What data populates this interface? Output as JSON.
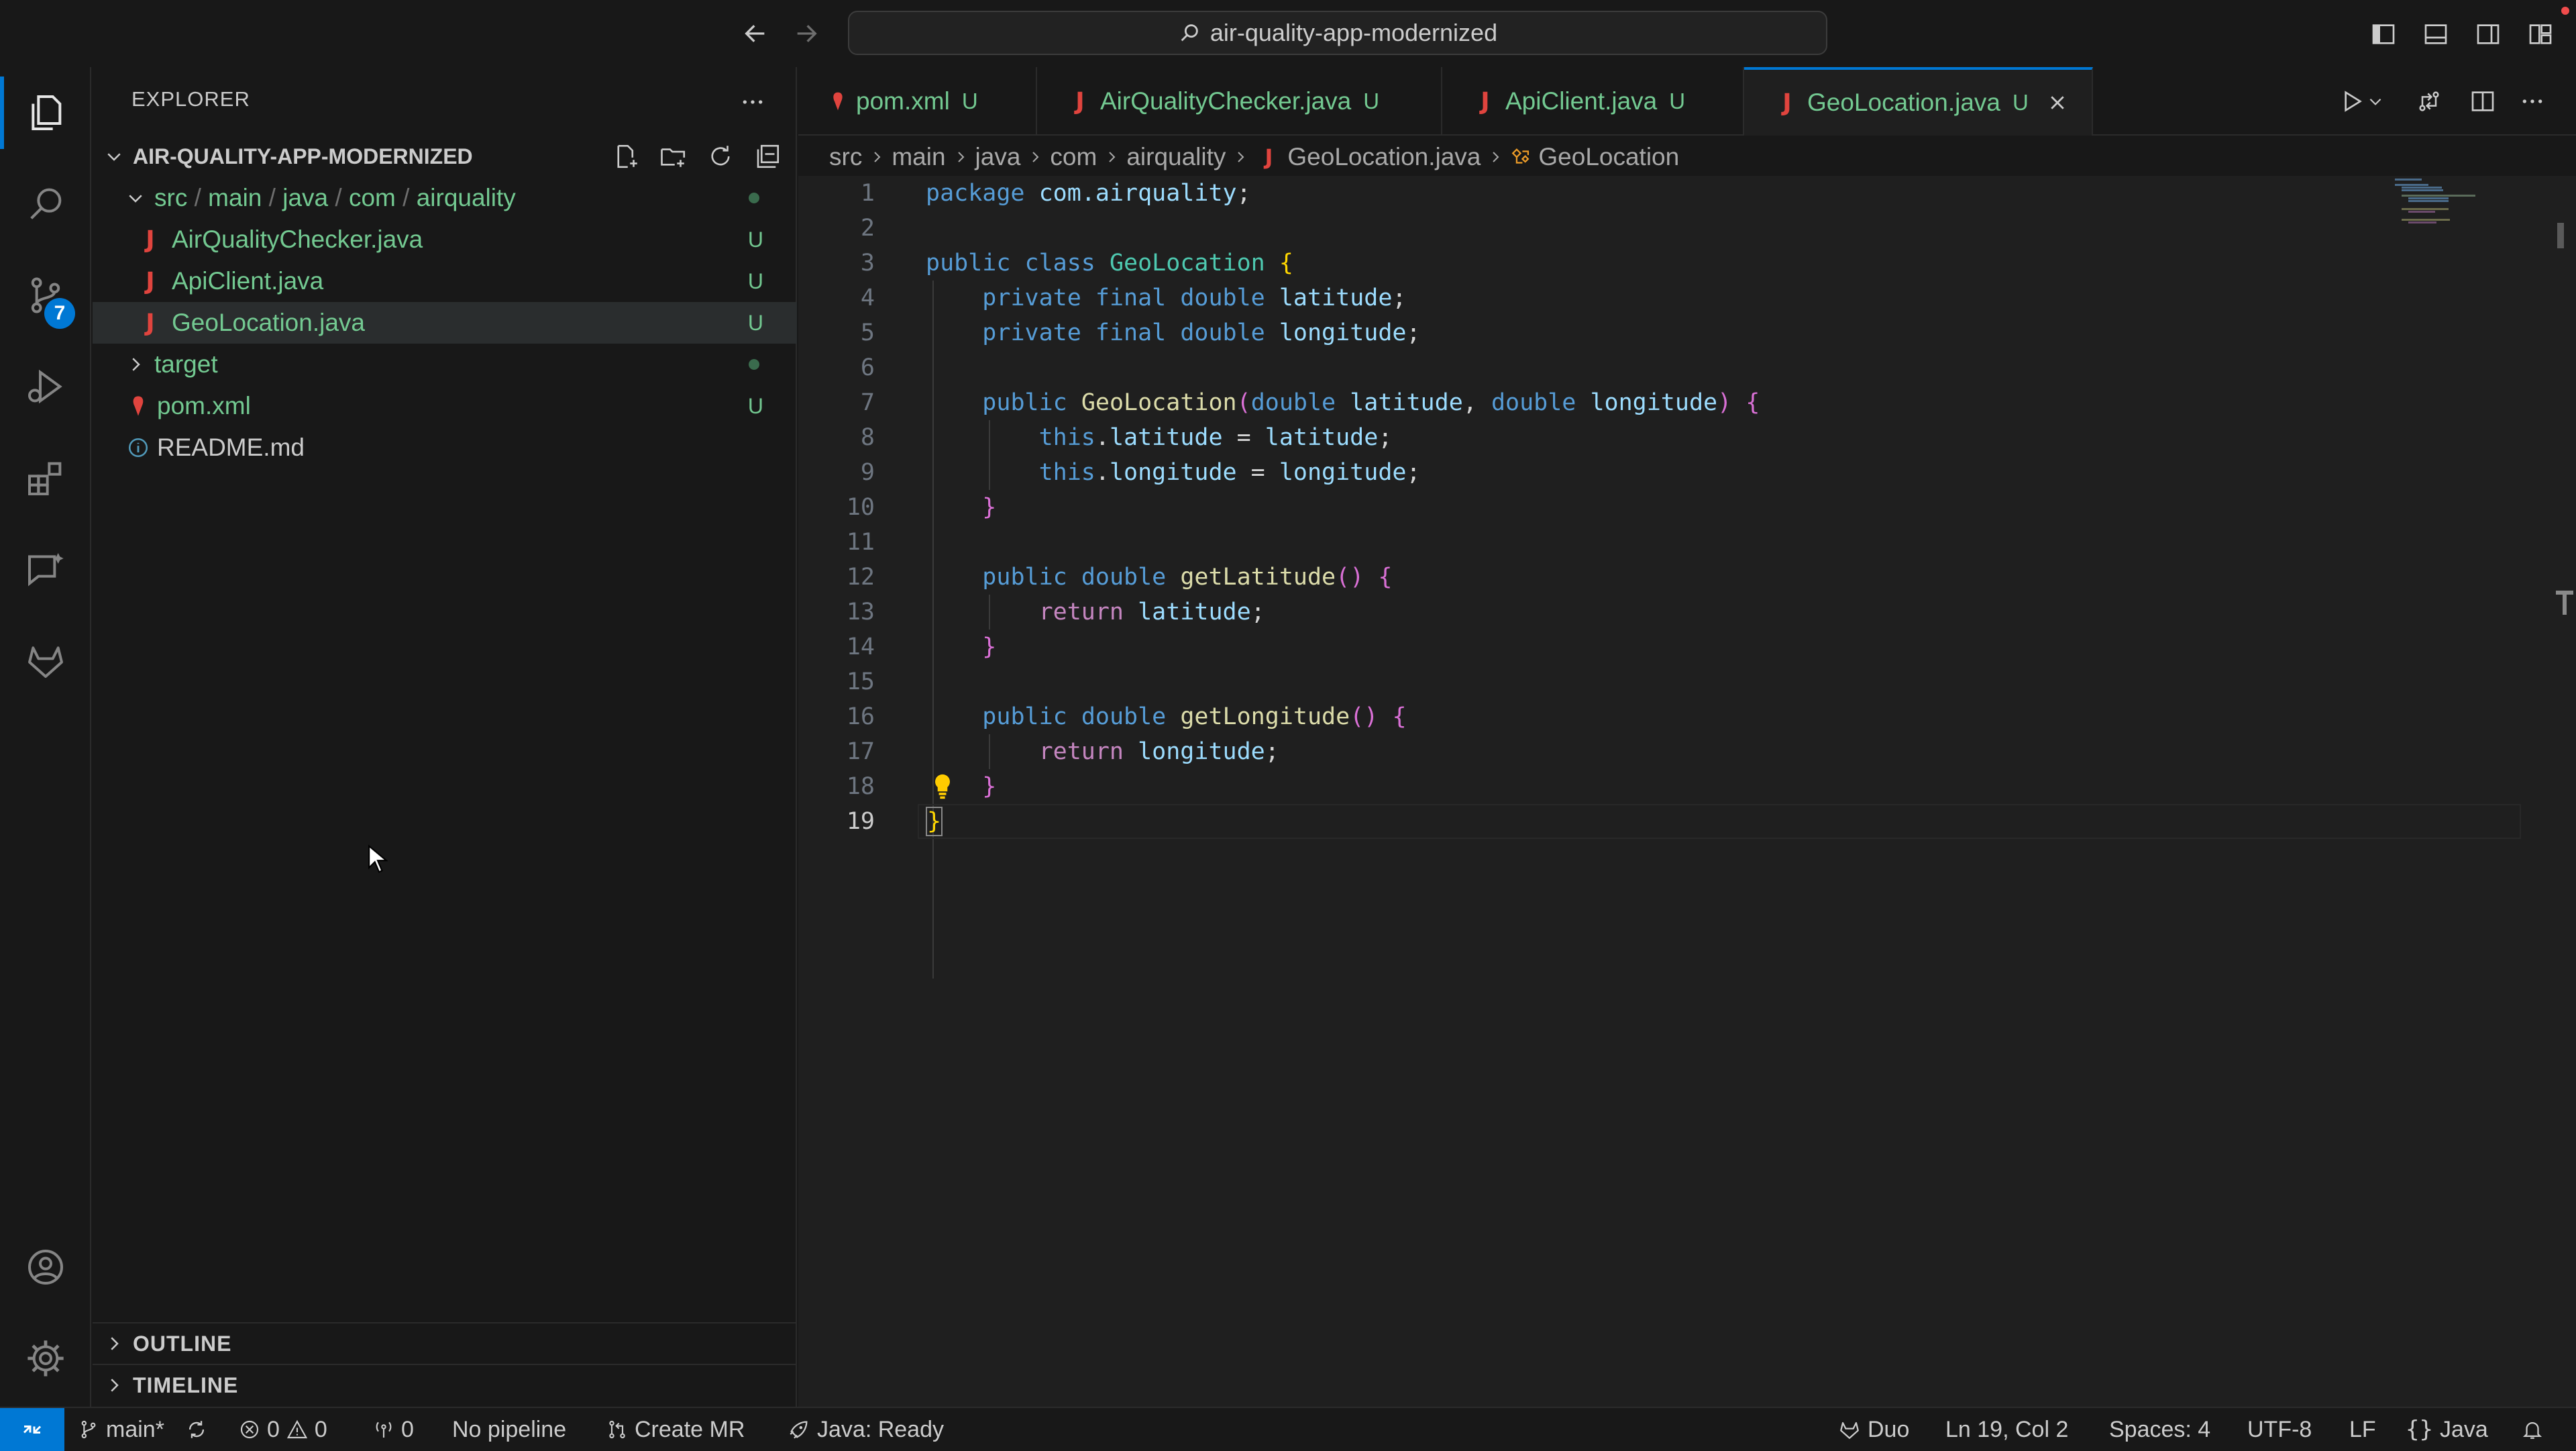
{
  "titlebar": {
    "search_text": "air-quality-app-modernized"
  },
  "activity": {
    "scm_badge": "7"
  },
  "explorer": {
    "title": "EXPLORER",
    "project": "AIR-QUALITY-APP-MODERNIZED",
    "folder_path": [
      "src",
      "main",
      "java",
      "com",
      "airquality"
    ],
    "files": [
      {
        "name": "AirQualityChecker.java",
        "status": "U"
      },
      {
        "name": "ApiClient.java",
        "status": "U"
      },
      {
        "name": "GeoLocation.java",
        "status": "U"
      }
    ],
    "target": "target",
    "pom": {
      "name": "pom.xml",
      "status": "U"
    },
    "readme": "README.md",
    "outline": "OUTLINE",
    "timeline": "TIMELINE"
  },
  "tabs": [
    {
      "name": "pom.xml",
      "status": "U"
    },
    {
      "name": "AirQualityChecker.java",
      "status": "U"
    },
    {
      "name": "ApiClient.java",
      "status": "U"
    },
    {
      "name": "GeoLocation.java",
      "status": "U"
    }
  ],
  "breadcrumb": [
    "src",
    "main",
    "java",
    "com",
    "airquality",
    "GeoLocation.java",
    "GeoLocation"
  ],
  "editor": {
    "line_numbers": [
      "1",
      "2",
      "3",
      "4",
      "5",
      "6",
      "7",
      "8",
      "9",
      "10",
      "11",
      "12",
      "13",
      "14",
      "15",
      "16",
      "17",
      "18",
      "19"
    ],
    "tokens": {
      "package": "package",
      "pkg": "com.airquality",
      "public": "public",
      "class": "class",
      "classname": "GeoLocation",
      "private": "private",
      "final": "final",
      "double": "double",
      "latitude": "latitude",
      "longitude": "longitude",
      "this": "this",
      "return": "return",
      "getLatitude": "getLatitude",
      "getLongitude": "getLongitude"
    }
  },
  "statusbar": {
    "branch": "main*",
    "errors": "0",
    "warnings": "0",
    "ports": "0",
    "pipeline": "No pipeline",
    "create_mr": "Create MR",
    "java_status": "Java: Ready",
    "duo": "Duo",
    "position": "Ln 19, Col 2",
    "spaces": "Spaces: 4",
    "encoding": "UTF-8",
    "eol": "LF",
    "language": "Java"
  }
}
